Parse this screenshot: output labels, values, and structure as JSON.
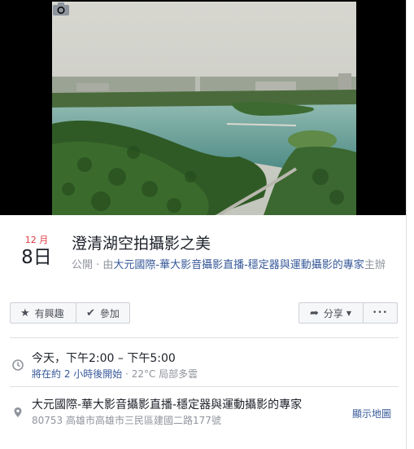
{
  "event": {
    "month": "12 月",
    "day": "8日",
    "title": "澄清湖空拍攝影之美",
    "privacy": "公開",
    "by_prefix": " · 由",
    "host": "大元國際-華大影音攝影直播-穩定器與運動攝影的專家",
    "host_suffix": "主辦"
  },
  "buttons": {
    "interested": "有興趣",
    "going": "參加",
    "share": "分享",
    "more": "•••"
  },
  "time": {
    "main": "今天，下午2:00 – 下午5:00",
    "starts_in": "將在約 2 小時後開始",
    "weather": " · 22°C 局部多雲"
  },
  "location": {
    "name": "大元國際-華大影音攝影直播-穩定器與運動攝影的專家",
    "address": "80753 高雄市高雄市三民區建國二路177號",
    "map_link": "顯示地圖"
  },
  "icons": [
    "camera-icon",
    "star-icon",
    "check-icon",
    "share-icon",
    "dropdown-icon",
    "clock-icon",
    "pin-icon"
  ]
}
